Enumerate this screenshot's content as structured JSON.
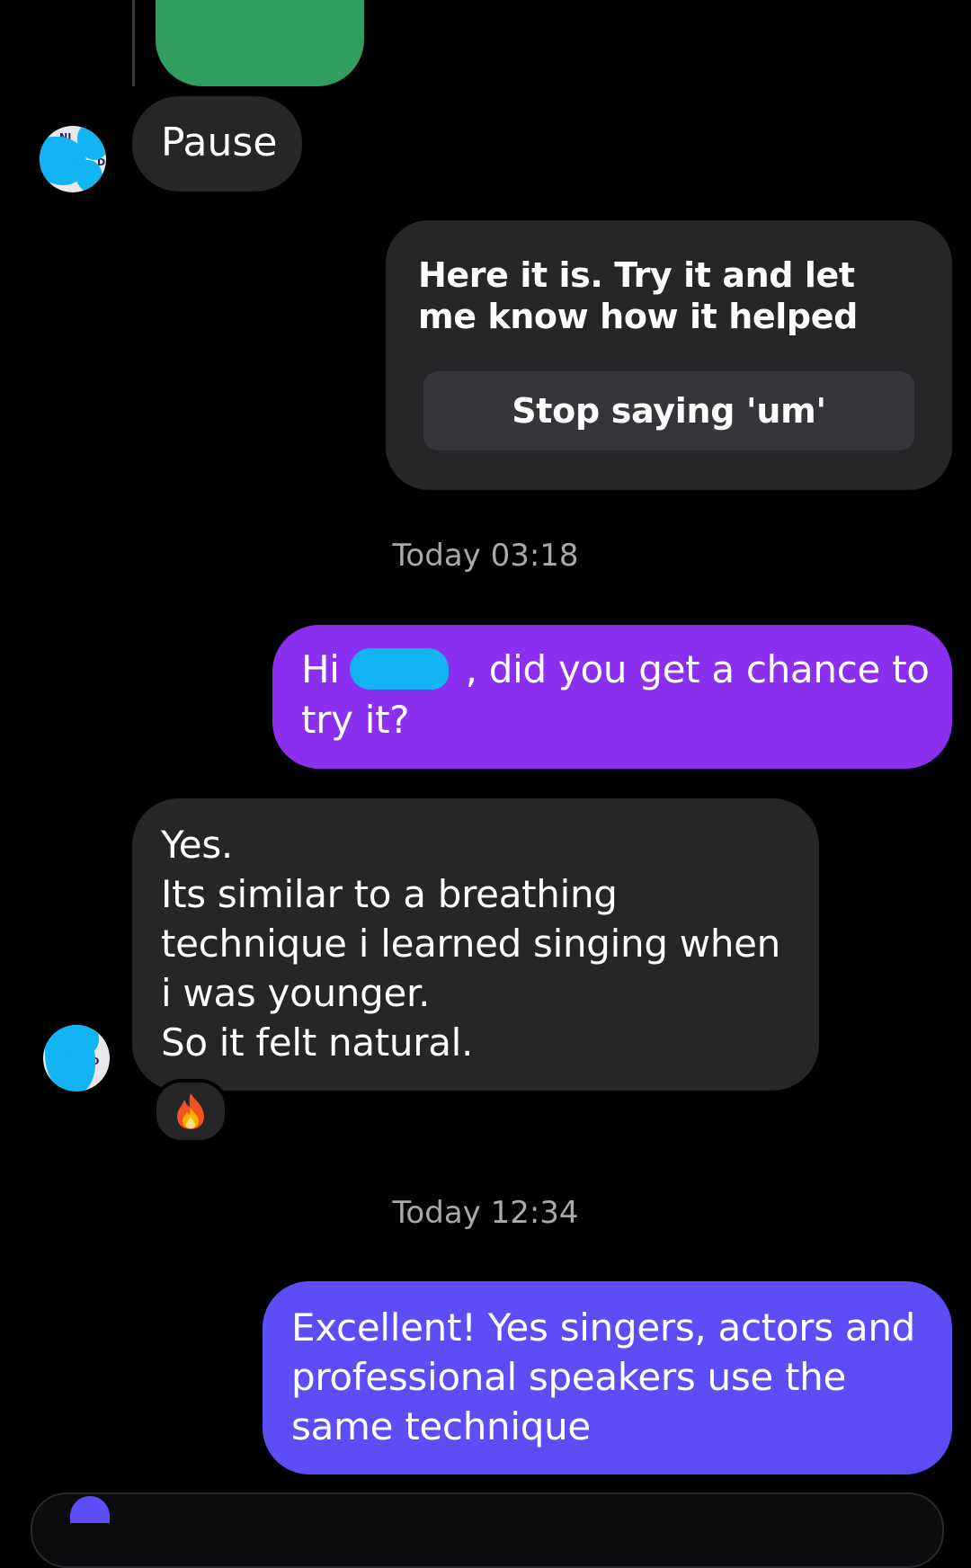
{
  "messages": {
    "pause": "Pause",
    "card_text": "Here it is. Try it and let me know how it helped",
    "card_button": "Stop saying 'um'",
    "timestamp_1": "Today 03:18",
    "sent_1_a": "Hi",
    "sent_1_b": ", did you get a chance to",
    "sent_1_c": "try it?",
    "received_lines": [
      "Yes.",
      "Its similar to a breathing",
      "technique i learned singing when",
      "i was younger.",
      "So it felt natural."
    ],
    "reaction_icon": "fire-emoji",
    "timestamp_2": "Today 12:34",
    "sent_2_lines": [
      "Excellent! Yes singers, actors and",
      "professional speakers use the",
      "same technique"
    ]
  },
  "colors": {
    "background": "#000000",
    "received_bubble": "#262628",
    "sent_bubble_purple": "#8b2ff0",
    "sent_bubble_indigo": "#5c4ef6",
    "redaction": "#13b4f3",
    "media_preview": "#2f9e5f"
  }
}
